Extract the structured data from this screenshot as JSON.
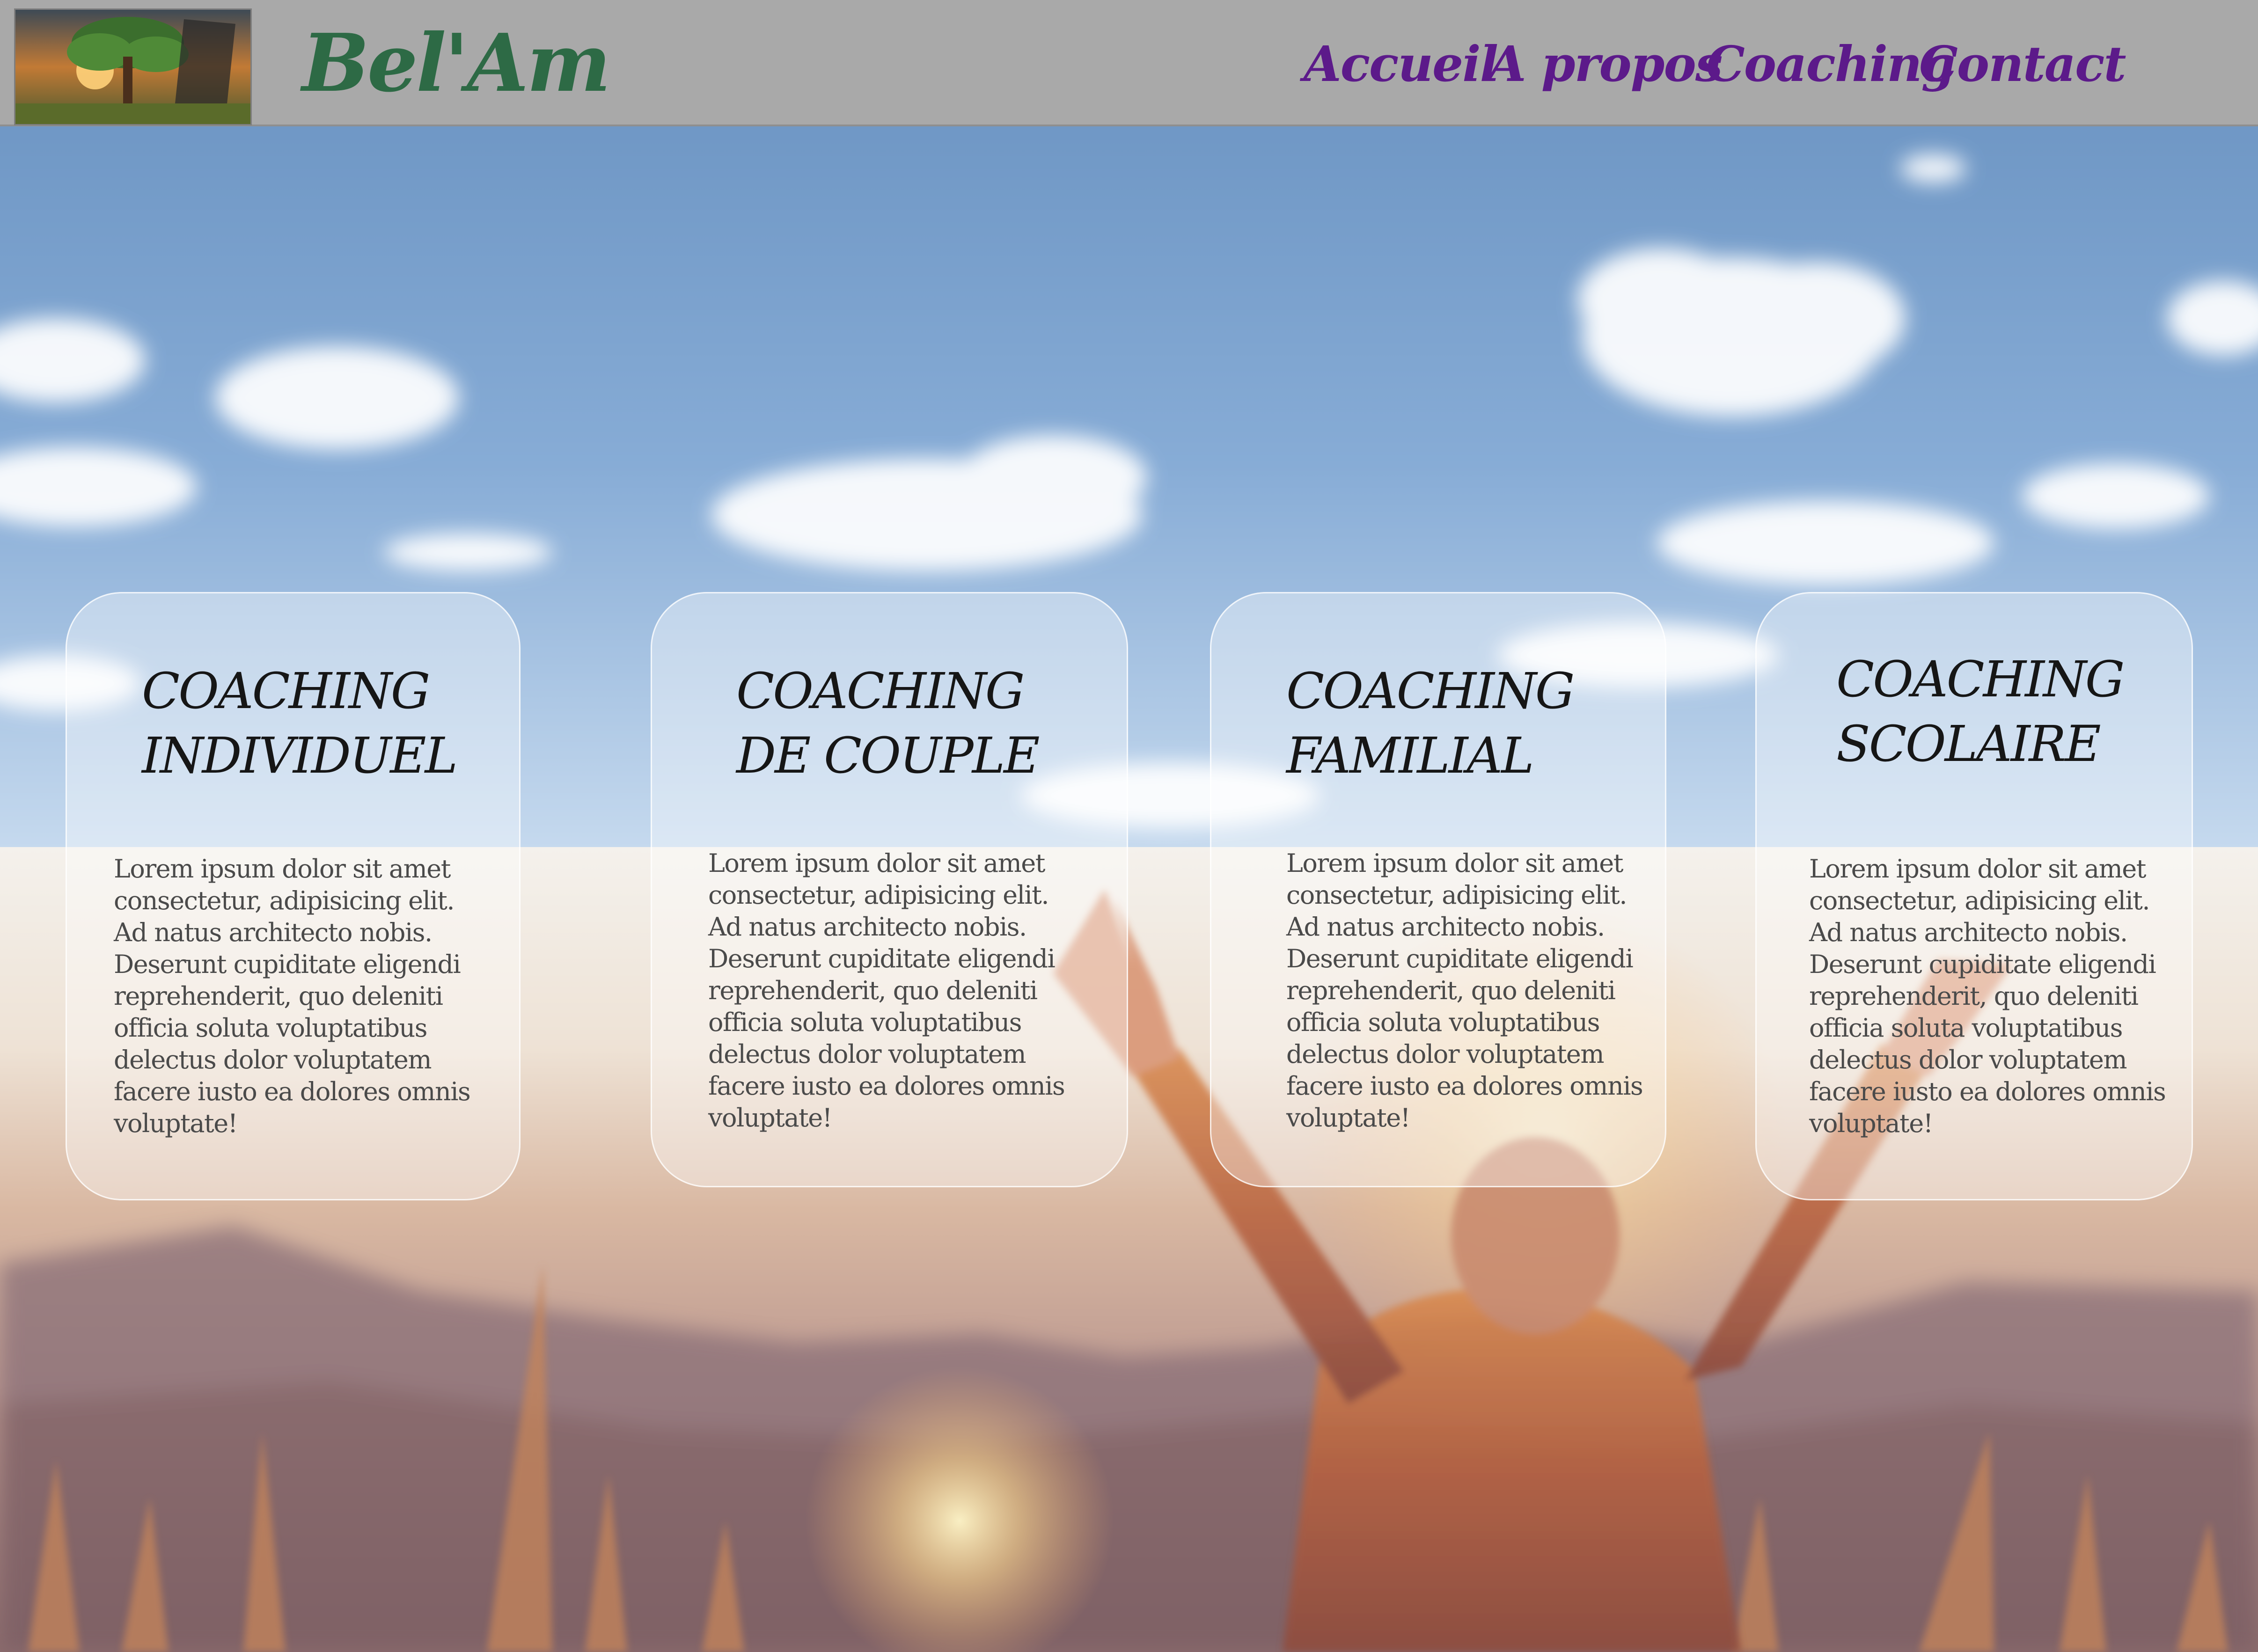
{
  "site": {
    "brand": "Bel'Am",
    "logo_alt": "tree-at-sunset-logo"
  },
  "nav": {
    "items": [
      {
        "label": "Accueil"
      },
      {
        "label": "A propos"
      },
      {
        "label": "Coaching"
      },
      {
        "label": "Contact"
      }
    ]
  },
  "cards": [
    {
      "title_lines": [
        "COACHING",
        "INDIVIDUEL"
      ],
      "body_lines": [
        "Lorem ipsum dolor sit amet",
        "consectetur, adipisicing elit.",
        "Ad natus architecto nobis.",
        "Deserunt cupiditate eligendi",
        "reprehenderit, quo deleniti",
        "officia soluta voluptatibus",
        "delectus dolor voluptatem",
        "facere iusto ea dolores omnis",
        "voluptate!"
      ]
    },
    {
      "title_lines": [
        "COACHING",
        "DE COUPLE"
      ],
      "body_lines": [
        "Lorem ipsum dolor sit amet",
        "consectetur, adipisicing elit.",
        "Ad natus architecto nobis.",
        "Deserunt cupiditate eligendi",
        "reprehenderit, quo deleniti",
        "officia soluta voluptatibus",
        "delectus dolor voluptatem",
        "facere iusto ea dolores omnis",
        "voluptate!"
      ]
    },
    {
      "title_lines": [
        "COACHING",
        "FAMILIAL"
      ],
      "body_lines": [
        "Lorem ipsum dolor sit amet",
        "consectetur, adipisicing elit.",
        "Ad natus architecto nobis.",
        "Deserunt cupiditate eligendi",
        "reprehenderit, quo deleniti",
        "officia soluta voluptatibus",
        "delectus dolor voluptatem",
        "facere iusto ea dolores omnis",
        "voluptate!"
      ]
    },
    {
      "title_lines": [
        "COACHING",
        "SCOLAIRE"
      ],
      "body_lines": [
        "Lorem ipsum dolor sit amet",
        "consectetur, adipisicing elit.",
        "Ad natus architecto nobis.",
        "Deserunt cupiditate eligendi",
        "reprehenderit, quo deleniti",
        "officia soluta voluptatibus",
        "delectus dolor voluptatem",
        "facere iusto ea dolores omnis",
        "voluptate!"
      ]
    }
  ],
  "colors": {
    "header_bg": "#a9a9a9",
    "brand": "#2d6a45",
    "nav": "#5c1a8a",
    "sky_top": "#6e98c6",
    "sky_bottom": "#c9dcef",
    "sunset": "#e8b98a"
  },
  "hero": {
    "image": "person-raising-arms-at-sunset-under-cloudy-sky"
  }
}
